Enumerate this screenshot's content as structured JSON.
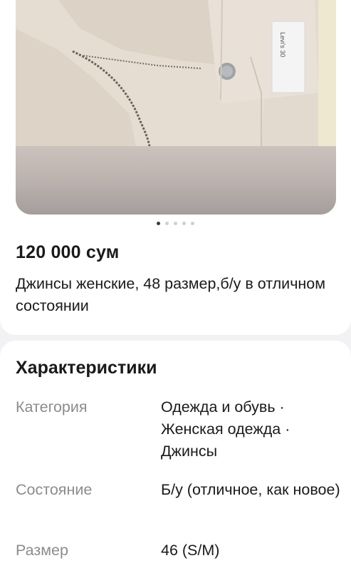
{
  "listing": {
    "price": "120 000 сум",
    "title": "Джинсы женские, 48 размер,б/у в отличном состоянии",
    "photo_count": 5,
    "active_photo_index": 0
  },
  "characteristics": {
    "heading": "Характеристики",
    "rows": [
      {
        "label": "Категория",
        "value": "Одежда и обувь · Женская одежда · Джинсы"
      },
      {
        "label": "Состояние",
        "value": "Б/у (отличное, как новое)"
      },
      {
        "label": "Размер",
        "value": "46 (S/M)"
      }
    ]
  },
  "photo": {
    "label_text": "Levi's 30",
    "colors": {
      "denim": "#e3dacf",
      "label": "#f4f4f4"
    }
  }
}
